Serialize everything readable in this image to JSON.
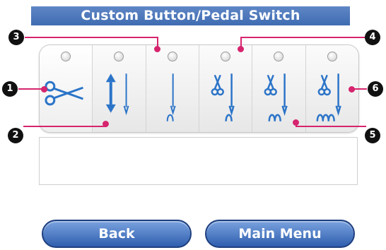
{
  "header": {
    "title": "Custom Button/Pedal Switch"
  },
  "options": [
    {
      "icon": "scissors-icon",
      "badge": "1"
    },
    {
      "icon": "needle-up-down-icon",
      "badge": "2"
    },
    {
      "icon": "needle-down-icon",
      "badge": "3"
    },
    {
      "icon": "thread-cutter-icon",
      "badge": "4"
    },
    {
      "icon": "thread-cutter-reverse-icon",
      "badge": "5"
    },
    {
      "icon": "thread-cutter-triple-icon",
      "badge": "6"
    }
  ],
  "colors": {
    "title_bg": "#4a74b8",
    "callout": "#d6246e",
    "pill": "#3d6cb8"
  },
  "buttons": {
    "back": "Back",
    "main_menu": "Main Menu"
  }
}
